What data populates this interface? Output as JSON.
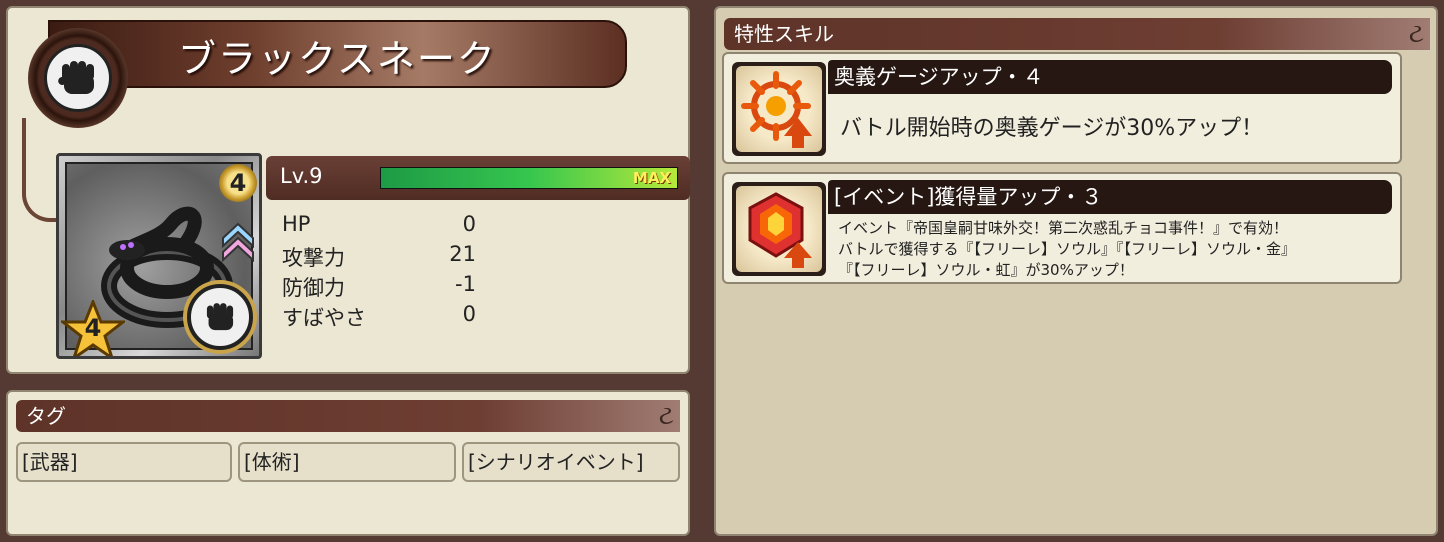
{
  "character": {
    "name": "ブラックスネーク",
    "level_badge": "4",
    "rarity": "4",
    "level_label": "Lv.9",
    "exp_fraction": 1.0,
    "exp_max_label": "MAX",
    "type_icon": "fist-icon"
  },
  "stats": [
    {
      "label": "HP",
      "value": "0"
    },
    {
      "label": "攻撃力",
      "value": "21"
    },
    {
      "label": "防御力",
      "value": "-1"
    },
    {
      "label": "すばやさ",
      "value": "0"
    }
  ],
  "tags": {
    "header": "タグ",
    "items": [
      "[武器]",
      "[体術]",
      "[シナリオイベント]"
    ]
  },
  "skills": {
    "header": "特性スキル",
    "items": [
      {
        "title": "奥義ゲージアップ・４",
        "icon": "ougi-gauge-icon",
        "description": "バトル開始時の奥義ゲージが30%アップ！"
      },
      {
        "title": "[イベント]獲得量アップ・３",
        "icon": "gem-icon",
        "description_lines": [
          "イベント『帝国皇嗣甘味外交！第二次惑乱チョコ事件！』で有効！",
          "バトルで獲得する『【フリーレ】ソウル』『【フリーレ】ソウル・金』",
          "『【フリーレ】ソウル・虹』が30%アップ！"
        ]
      }
    ]
  },
  "colors": {
    "panel_bg": "#ece7d3",
    "page_bg": "#553a33",
    "header_bg": "#5e3328",
    "exp_green": "#36c64e",
    "max_yellow": "#ffef5a"
  }
}
